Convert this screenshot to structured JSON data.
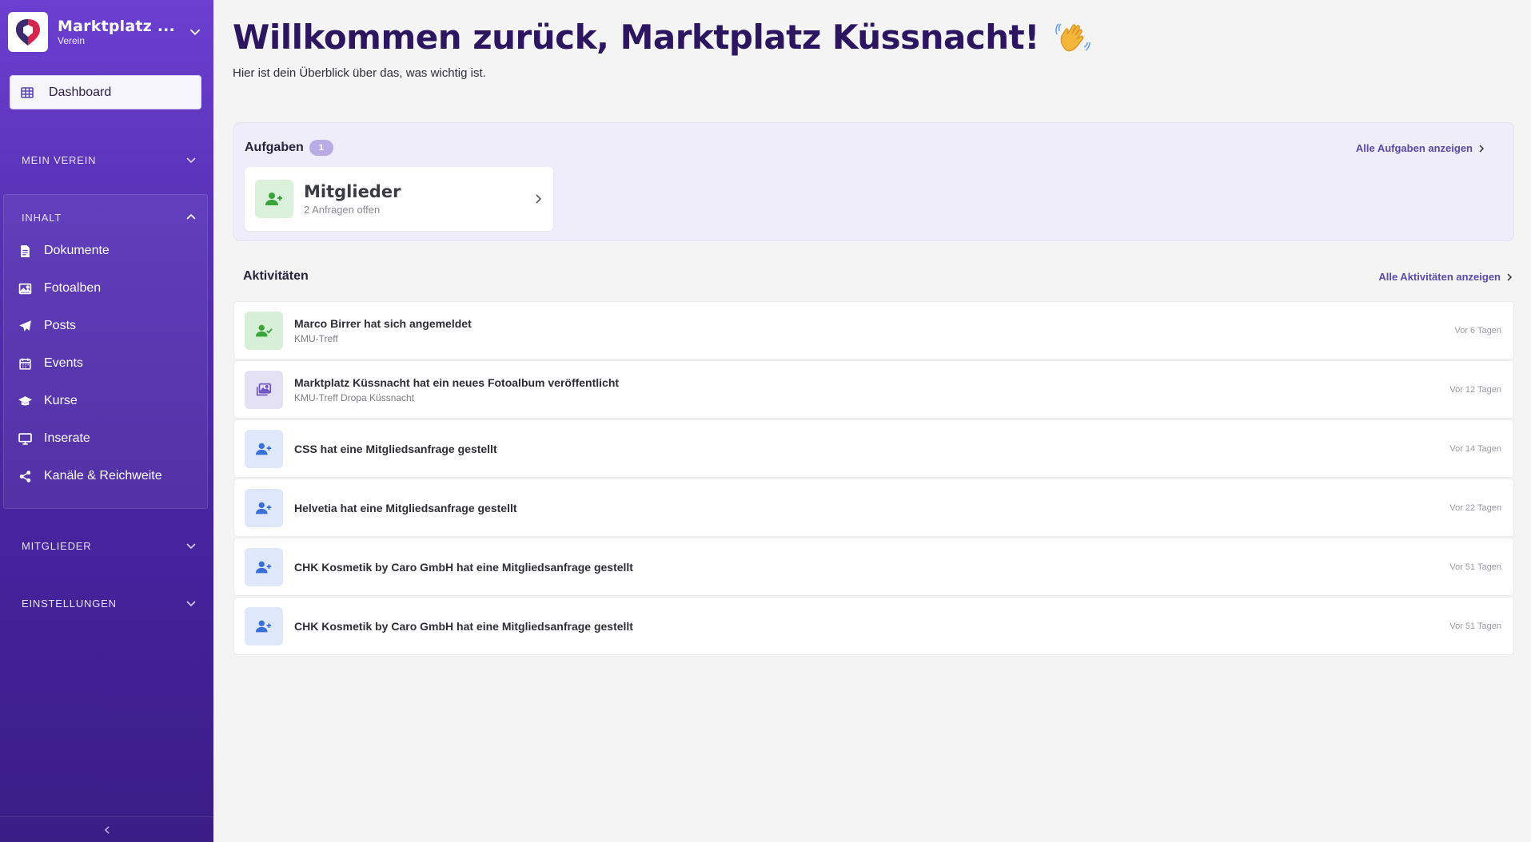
{
  "sidebar": {
    "org_name": "Marktplatz ...",
    "org_type": "Verein",
    "dashboard_label": "Dashboard",
    "sections": {
      "mein_verein": "MEIN VEREIN",
      "inhalt": "INHALT",
      "mitglieder": "MITGLIEDER",
      "einstellungen": "EINSTELLUNGEN"
    },
    "items": [
      {
        "label": "Dokumente",
        "icon": "document-icon"
      },
      {
        "label": "Fotoalben",
        "icon": "image-icon"
      },
      {
        "label": "Posts",
        "icon": "paper-plane-icon"
      },
      {
        "label": "Events",
        "icon": "calendar-icon"
      },
      {
        "label": "Kurse",
        "icon": "graduation-cap-icon"
      },
      {
        "label": "Inserate",
        "icon": "monitor-icon"
      },
      {
        "label": "Kanäle & Reichweite",
        "icon": "share-icon"
      }
    ]
  },
  "header": {
    "title": "Willkommen zurück, Marktplatz Küssnacht!",
    "subtitle": "Hier ist dein Überblick über das, was wichtig ist."
  },
  "tasks": {
    "title": "Aufgaben",
    "count": "1",
    "all_link": "Alle Aufgaben anzeigen",
    "card": {
      "title": "Mitglieder",
      "subtitle": "2 Anfragen offen"
    }
  },
  "activities": {
    "title": "Aktivitäten",
    "all_link": "Alle Aktivitäten anzeigen",
    "items": [
      {
        "title": "Marco Birrer hat sich angemeldet",
        "subtitle": "KMU-Treff",
        "time": "Vor 6 Tagen",
        "icon": "user-check-icon"
      },
      {
        "title": "Marktplatz Küssnacht hat ein neues Fotoalbum veröffentlicht",
        "subtitle": "KMU-Treff Dropa Küssnacht",
        "time": "Vor 12 Tagen",
        "icon": "photo-album-icon"
      },
      {
        "title": "CSS hat eine Mitgliedsanfrage gestellt",
        "subtitle": "",
        "time": "Vor 14 Tagen",
        "icon": "user-plus-icon"
      },
      {
        "title": "Helvetia hat eine Mitgliedsanfrage gestellt",
        "subtitle": "",
        "time": "Vor 22 Tagen",
        "icon": "user-plus-icon"
      },
      {
        "title": "CHK Kosmetik by Caro GmbH hat eine Mitgliedsanfrage gestellt",
        "subtitle": "",
        "time": "Vor 51 Tagen",
        "icon": "user-plus-icon"
      },
      {
        "title": "CHK Kosmetik by Caro GmbH hat eine Mitgliedsanfrage gestellt",
        "subtitle": "",
        "time": "Vor 51 Tagen",
        "icon": "user-plus-icon"
      }
    ]
  },
  "colors": {
    "sidebar_top": "#6c3fd0",
    "sidebar_bottom": "#3a1d85",
    "title": "#2d1660",
    "link": "#5a4aa8",
    "green_icon": "#3aa33a",
    "blue_icon": "#3b6fd8",
    "purple_icon": "#6a4fc0"
  }
}
